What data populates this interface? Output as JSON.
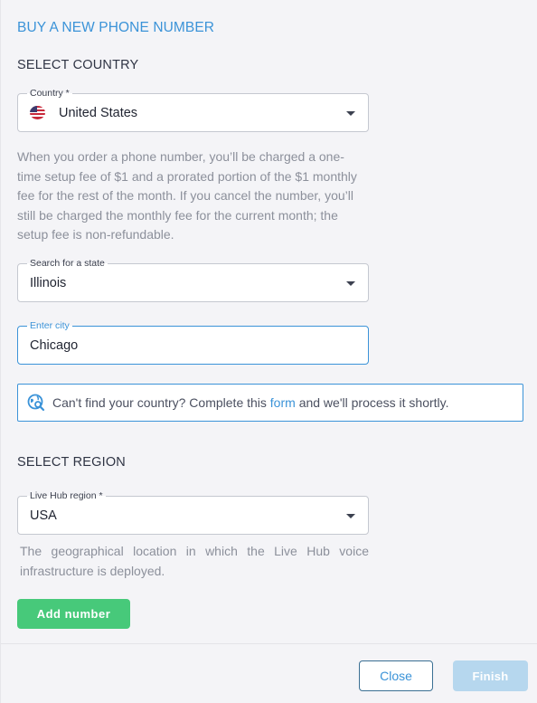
{
  "page_title": "BUY A NEW PHONE NUMBER",
  "select_country": {
    "section_title": "SELECT COUNTRY",
    "country_field": {
      "label": "Country *",
      "value": "United States",
      "flag_icon": "us-flag-icon"
    },
    "fee_notice": "When you order a phone number, you’ll be charged a one-time setup fee of $1 and a prorated portion of the $1 monthly fee for the rest of the month. If you cancel the number, you’ll still be charged the monthly fee for the current month; the setup fee is non-refundable.",
    "state_field": {
      "label": "Search for a state",
      "value": "Illinois"
    },
    "city_field": {
      "label": "Enter city",
      "value": "Chicago"
    },
    "info_box": {
      "icon": "globe-search-icon",
      "text_before": "Can't find your country? Complete this",
      "link_text": "form",
      "text_after": "and we'll process it shortly."
    }
  },
  "select_region": {
    "section_title": "SELECT REGION",
    "region_field": {
      "label": "Live Hub region *",
      "value": "USA"
    },
    "help_text": "The geographical location in which the Live Hub voice infrastructure is deployed."
  },
  "add_number_label": "Add number",
  "footer": {
    "close_label": "Close",
    "finish_label": "Finish"
  },
  "colors": {
    "accent": "#3b93d8",
    "success": "#47c97a",
    "disabled_primary": "#b6d7ee",
    "muted_text": "#8c909b",
    "background": "#f4f4f7"
  }
}
